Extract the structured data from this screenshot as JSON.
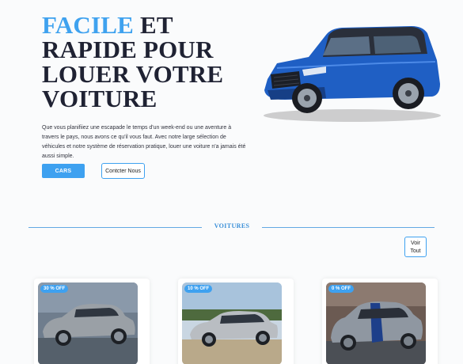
{
  "hero": {
    "title_accent": "FACILE",
    "title_rest_1": " ET",
    "title_line_2": "RAPIDE POUR",
    "title_line_3": "LOUER VOTRE",
    "title_line_4": "VOITURE",
    "description": "Que vous planifiiez une escapade le temps d'un week-end ou une aventure à travers le pays, nous avons ce qu'il vous faut. Avec notre large sélection de véhicules et notre système de réservation pratique, louer une voiture n'a jamais été aussi simple.",
    "primary_button": "CARS",
    "secondary_button": "Contcter Nous"
  },
  "section": {
    "title": "VOITURES",
    "view_all_line1": "Voir",
    "view_all_line2": "Tout"
  },
  "cards": [
    {
      "badge": "30 % OFF",
      "car_color": "#9aa0a6"
    },
    {
      "badge": "10 % OFF",
      "car_color": "#b9bdc2"
    },
    {
      "badge": "0 % OFF",
      "car_color": "#8f97a1"
    }
  ],
  "colors": {
    "accent": "#3ea1f0",
    "title_dark": "#1f2233",
    "hero_car": "#1f5fc4"
  }
}
